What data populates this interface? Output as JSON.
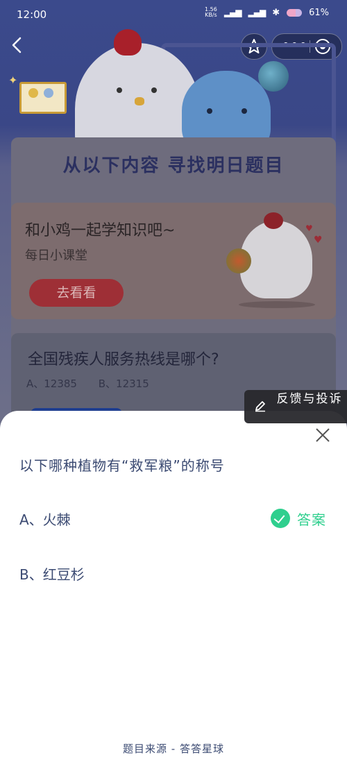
{
  "status_bar": {
    "time": "12:00",
    "net_speed_value": "1.56",
    "net_speed_unit": "KB/s",
    "battery": "61%"
  },
  "background": {
    "panel_title": "从以下内容 寻找明日题目",
    "promo": {
      "title": "和小鸡一起学知识吧~",
      "subtitle": "每日小课堂",
      "button": "去看看"
    },
    "quiz": {
      "question": "全国残疾人服务热线是哪个?",
      "option_a": "A、12385",
      "option_b": "B、12315"
    }
  },
  "feedback": {
    "label": "反馈与投诉"
  },
  "sheet": {
    "question": "以下哪种植物有“救军粮”的称号",
    "options": [
      {
        "label": "A、火棘",
        "is_answer": true
      },
      {
        "label": "B、红豆杉",
        "is_answer": false
      }
    ],
    "answer_label": "答案",
    "source": "题目来源 - 答答星球"
  },
  "icons": {
    "back": "chevron-left-icon",
    "star": "star-icon",
    "more": "more-dots-icon",
    "target": "target-icon",
    "close": "close-icon",
    "check": "check-circle-icon",
    "pen": "pen-icon"
  },
  "colors": {
    "accent_green": "#2fcf8e",
    "text_blue": "#3b4a72",
    "promo_button": "#9e2f36",
    "header_bg": "#3b4a8c"
  }
}
